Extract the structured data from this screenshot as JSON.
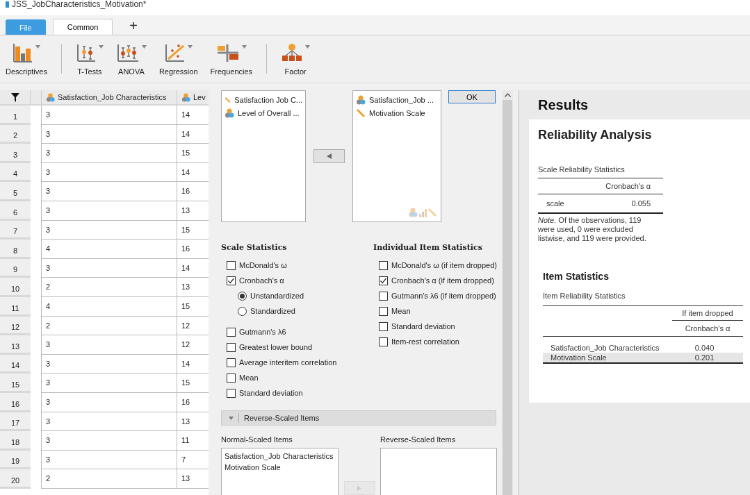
{
  "window": {
    "title": "JSS_JobCharacteristics_Motivation*"
  },
  "tabs": [
    {
      "label": "File",
      "kind": "file",
      "selected": false
    },
    {
      "label": "Common",
      "kind": "tab",
      "selected": true
    }
  ],
  "add_tab": "+",
  "toolbar_groups": [
    {
      "buttons": [
        {
          "label": "Descriptives",
          "kind": "descriptives"
        }
      ]
    },
    {
      "buttons": [
        {
          "label": "T-Tests",
          "kind": "ttest"
        },
        {
          "label": "ANOVA",
          "kind": "anova"
        },
        {
          "label": "Regression",
          "kind": "regression"
        },
        {
          "label": "Frequencies",
          "kind": "frequencies"
        }
      ]
    },
    {
      "buttons": [
        {
          "label": "Factor",
          "kind": "factor"
        }
      ]
    }
  ],
  "data_table": {
    "columns": [
      {
        "name": "Satisfaction_Job Characteristics"
      },
      {
        "name": "Lev"
      }
    ],
    "rows": [
      {
        "number": "1",
        "cells": [
          "3",
          "14"
        ]
      },
      {
        "number": "2",
        "cells": [
          "3",
          "14"
        ]
      },
      {
        "number": "3",
        "cells": [
          "3",
          "15"
        ]
      },
      {
        "number": "4",
        "cells": [
          "3",
          "14"
        ]
      },
      {
        "number": "5",
        "cells": [
          "3",
          "16"
        ]
      },
      {
        "number": "6",
        "cells": [
          "3",
          "13"
        ]
      },
      {
        "number": "7",
        "cells": [
          "3",
          "15"
        ]
      },
      {
        "number": "8",
        "cells": [
          "4",
          "16"
        ]
      },
      {
        "number": "9",
        "cells": [
          "3",
          "14"
        ]
      },
      {
        "number": "10",
        "cells": [
          "2",
          "13"
        ]
      },
      {
        "number": "11",
        "cells": [
          "4",
          "15"
        ]
      },
      {
        "number": "12",
        "cells": [
          "2",
          "12"
        ]
      },
      {
        "number": "13",
        "cells": [
          "3",
          "12"
        ]
      },
      {
        "number": "14",
        "cells": [
          "3",
          "14"
        ]
      },
      {
        "number": "15",
        "cells": [
          "3",
          "15"
        ]
      },
      {
        "number": "16",
        "cells": [
          "3",
          "16"
        ]
      },
      {
        "number": "17",
        "cells": [
          "3",
          "13"
        ]
      },
      {
        "number": "18",
        "cells": [
          "3",
          "11"
        ]
      },
      {
        "number": "19",
        "cells": [
          "3",
          "7"
        ]
      },
      {
        "number": "20",
        "cells": [
          "2",
          "13"
        ]
      }
    ]
  },
  "analysis": {
    "available": [
      {
        "label": "Satisfaction Job C...",
        "kind": "scale"
      },
      {
        "label": "Level of Overall ...",
        "kind": "nominal"
      }
    ],
    "chosen": [
      {
        "label": "Satisfaction_Job ...",
        "kind": "nominal"
      },
      {
        "label": "Motivation Scale",
        "kind": "scale"
      }
    ],
    "ok": "OK",
    "scale_statistics": {
      "title": "Scale Statistics",
      "options": [
        {
          "label": "McDonald's ω",
          "kind": "checkbox",
          "checked": false
        },
        {
          "label": "Cronbach's α",
          "kind": "checkbox",
          "checked": true
        },
        {
          "label": "Unstandardized",
          "kind": "radio",
          "checked": true
        },
        {
          "label": "Standardized",
          "kind": "radio",
          "checked": false
        },
        {
          "label": "Gutmann's λ6",
          "kind": "checkbox",
          "checked": false
        },
        {
          "label": "Greatest lower bound",
          "kind": "checkbox",
          "checked": false
        },
        {
          "label": "Average interitem correlation",
          "kind": "checkbox",
          "checked": false
        },
        {
          "label": "Mean",
          "kind": "checkbox",
          "checked": false
        },
        {
          "label": "Standard deviation",
          "kind": "checkbox",
          "checked": false
        }
      ]
    },
    "item_statistics": {
      "title": "Individual Item Statistics",
      "options": [
        {
          "label": "McDonald's ω (if item dropped)",
          "kind": "checkbox",
          "checked": false
        },
        {
          "label": "Cronbach's α (if item dropped)",
          "kind": "checkbox",
          "checked": true
        },
        {
          "label": "Gutmann's λ6 (if item dropped)",
          "kind": "checkbox",
          "checked": false
        },
        {
          "label": "Mean",
          "kind": "checkbox",
          "checked": false
        },
        {
          "label": "Standard deviation",
          "kind": "checkbox",
          "checked": false
        },
        {
          "label": "Item-rest correlation",
          "kind": "checkbox",
          "checked": false
        }
      ]
    },
    "reverse_section": {
      "title": "Reverse-Scaled Items",
      "expanded": true
    },
    "normal_items": {
      "label": "Normal-Scaled Items",
      "items": [
        "Satisfaction_Job Characteristics",
        "Motivation Scale"
      ]
    },
    "reverse_items": {
      "label": "Reverse-Scaled Items"
    }
  },
  "results": {
    "title": "Results",
    "analysis_title": "Reliability Analysis",
    "scale_table": {
      "title": "Scale Reliability Statistics",
      "column": "Cronbach's α",
      "rows": [
        {
          "label": "scale",
          "value": "0.055"
        }
      ],
      "note": "*Note.* Of the observations, 119 were used, 0 were excluded listwise, and 119 were provided."
    },
    "item_heading": "Item Statistics",
    "item_table": {
      "title": "Item Reliability Statistics",
      "group_header": "If item dropped",
      "column": "Cronbach's α",
      "rows": [
        {
          "label": "Satisfaction_Job Characteristics",
          "value": "0.040",
          "selected": false
        },
        {
          "label": "Motivation Scale",
          "value": "0.201",
          "selected": true
        }
      ]
    }
  }
}
